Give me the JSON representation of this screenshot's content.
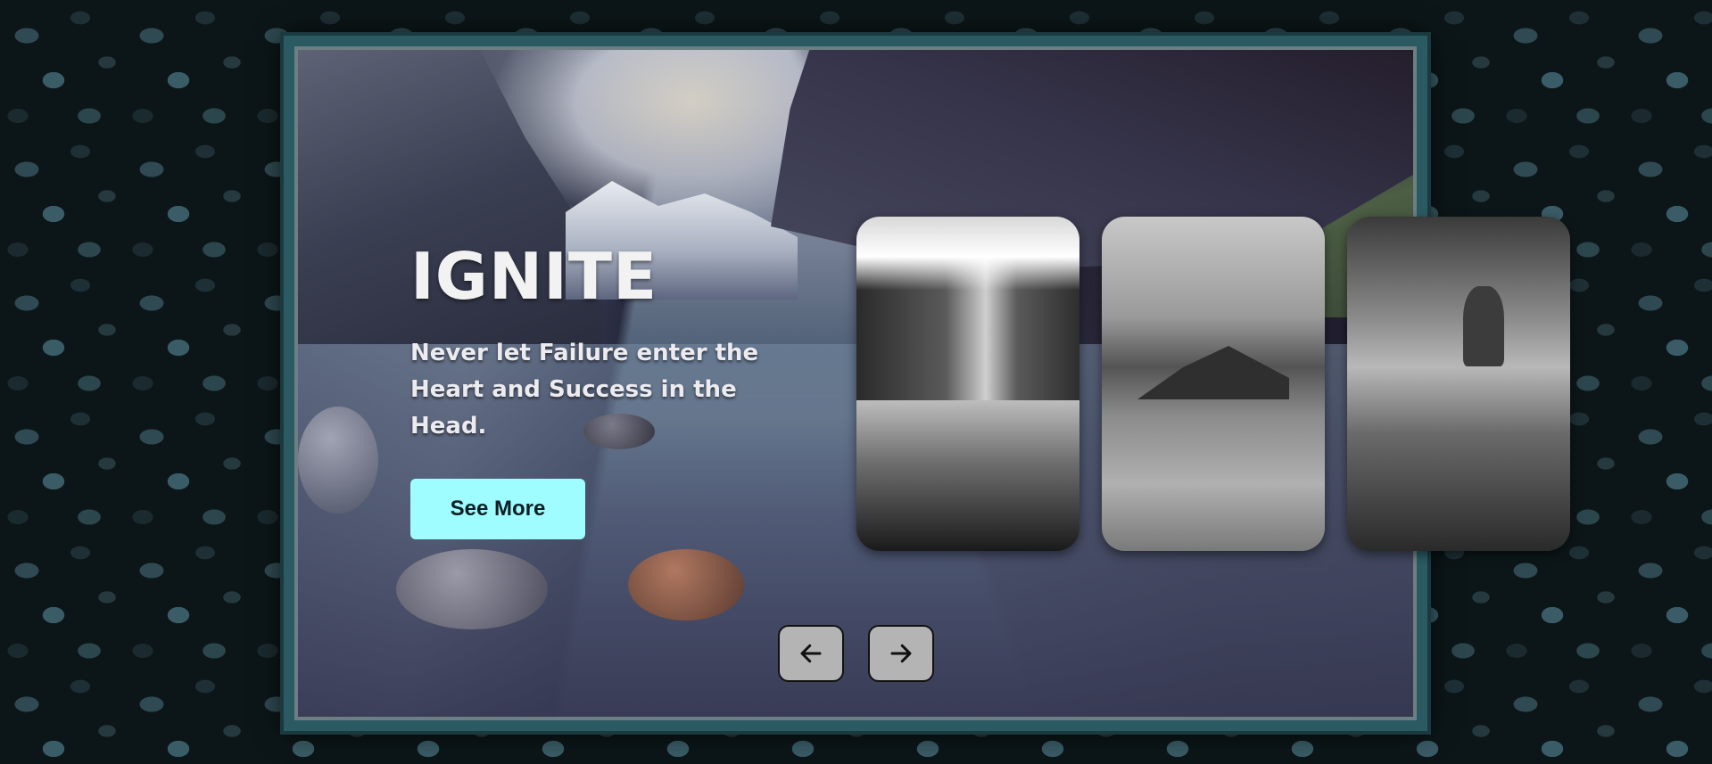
{
  "hero": {
    "title": "IGNITE",
    "subtitle": "Never let Failure enter the Heart and Success in the Head.",
    "cta_label": "See More"
  },
  "cards": [
    {
      "icon": "waterfall-photo"
    },
    {
      "icon": "island-photo"
    },
    {
      "icon": "sea-stacks-photo"
    }
  ],
  "navigation": {
    "prev_icon": "arrow-left-icon",
    "next_icon": "arrow-right-icon"
  },
  "colors": {
    "accent": "#9ffcff",
    "frame": "#2b5a63",
    "nav_button": "#b4b4b4"
  }
}
